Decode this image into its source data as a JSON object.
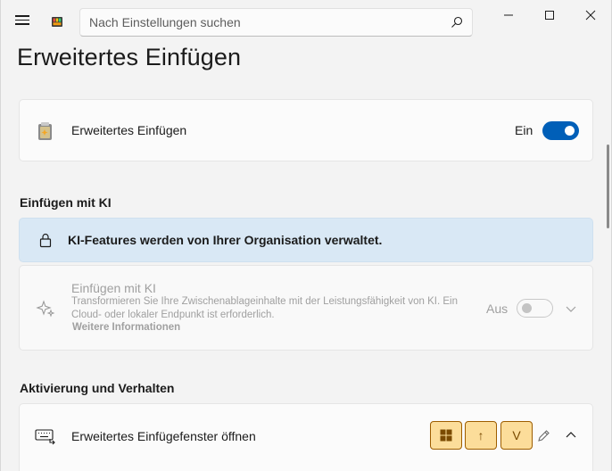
{
  "search": {
    "placeholder": "Nach Einstellungen suchen"
  },
  "page": {
    "title": "Erweitertes Einfügen"
  },
  "main_toggle": {
    "label": "Erweitertes Einfügen",
    "state": "Ein",
    "on": true
  },
  "section_ai": {
    "heading": "Einfügen mit KI",
    "info": "KI-Features werden von Ihrer Organisation verwaltet.",
    "card": {
      "title": "Einfügen mit KI",
      "description": "Transformieren Sie Ihre Zwischenablageinhalte mit der Leistungsfähigkeit von KI. Ein Cloud- oder lokaler Endpunkt ist erforderlich.",
      "link": "Weitere Informationen",
      "state": "Aus",
      "on": false
    }
  },
  "section_activation": {
    "heading": "Aktivierung und Verhalten",
    "shortcut": {
      "label": "Erweitertes Einfügefenster öffnen",
      "keys": [
        "win",
        "↑",
        "V"
      ]
    }
  },
  "colors": {
    "accent": "#005fb8",
    "info_bg": "#d9e8f5",
    "keycap_bg": "#fcdd9a",
    "keycap_border": "#9d5d00"
  },
  "icons": {
    "menu": "hamburger-icon",
    "app": "powertoys-icon",
    "search": "search-icon",
    "minimize": "minimize-icon",
    "maximize": "maximize-icon",
    "close": "close-icon",
    "paste": "advanced-paste-icon",
    "lock": "lock-icon",
    "sparkle": "sparkle-icon",
    "chevron": "chevron-down-icon",
    "keyboard": "keyboard-icon",
    "edit": "pencil-icon",
    "collapse": "chevron-up-icon"
  }
}
